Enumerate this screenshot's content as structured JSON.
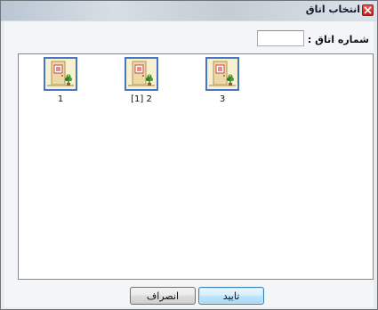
{
  "window": {
    "title": "انتخاب اتاق",
    "icon": "app-close-icon"
  },
  "form": {
    "room_number_label": "شماره اتاق :",
    "room_number_value": ""
  },
  "rooms": {
    "items": [
      {
        "label": "1",
        "icon": "room-door-icon"
      },
      {
        "label": "[1] 2",
        "icon": "room-door-icon"
      },
      {
        "label": "3",
        "icon": "room-door-icon"
      }
    ]
  },
  "buttons": {
    "confirm_label": "تایید",
    "cancel_label": "انصراف"
  },
  "colors": {
    "thumb_border": "#4677c2",
    "ok_border": "#3c7fb1"
  }
}
